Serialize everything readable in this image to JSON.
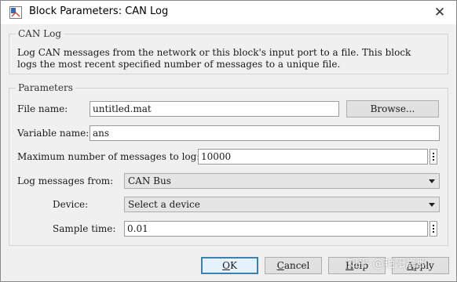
{
  "window": {
    "title": "Block Parameters: CAN Log",
    "close_glyph": "✕"
  },
  "block_group": {
    "title": "CAN Log",
    "description_line1": "Log CAN messages from the network or this block's input port to a file. This block",
    "description_line2": "logs the most recent specified number of messages to a unique file."
  },
  "parameters_group": {
    "title": "Parameters",
    "file_name": {
      "label": "File name:",
      "value": "untitled.mat",
      "browse_label": "Browse..."
    },
    "variable_name": {
      "label": "Variable name:",
      "value": "ans"
    },
    "max_messages": {
      "label": "Maximum number of messages to log:",
      "value": "10000"
    },
    "log_from": {
      "label": "Log messages from:",
      "selected": "CAN Bus"
    },
    "device": {
      "label": "Device:",
      "selected": "Select a device"
    },
    "sample_time": {
      "label": "Sample time:",
      "value": "0.01"
    }
  },
  "buttons": {
    "ok_mnemonic": "O",
    "ok_rest": "K",
    "cancel_mnemonic": "C",
    "cancel_rest": "ancel",
    "help_mnemonic": "H",
    "help_rest": "elp",
    "apply_mnemonic": "A",
    "apply_rest": "pply"
  },
  "watermark": "知乎 @艳阳高照",
  "colors": {
    "accent": "#3c7fb1",
    "app_icon": "#2f6db5"
  }
}
